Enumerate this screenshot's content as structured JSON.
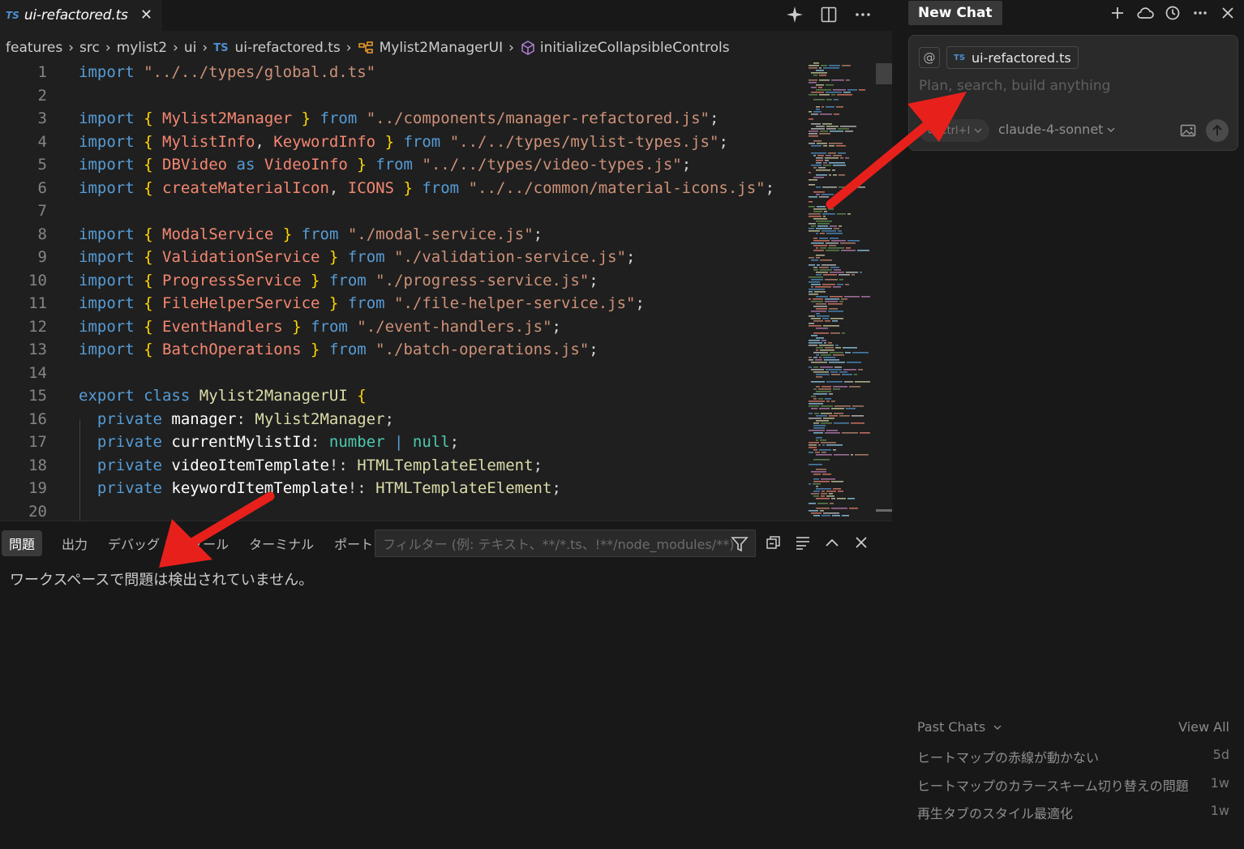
{
  "editor": {
    "tab": {
      "badge": "TS",
      "label": "ui-refactored.ts"
    },
    "tab_actions": [
      "sparkle-icon",
      "split-editor-icon",
      "more-icon"
    ],
    "breadcrumb": [
      {
        "label": "features"
      },
      {
        "label": "src"
      },
      {
        "label": "mylist2"
      },
      {
        "label": "ui"
      },
      {
        "label": "ui-refactored.ts",
        "badge": "TS"
      },
      {
        "label": "Mylist2ManagerUI",
        "icon": "class-icon"
      },
      {
        "label": "initializeCollapsibleControls",
        "icon": "method-cube-icon"
      }
    ],
    "code_lines": [
      {
        "n": "1",
        "tokens": [
          [
            "kw",
            "import"
          ],
          [
            "punc",
            " "
          ],
          [
            "str",
            "\"../../types/global.d.ts\""
          ]
        ]
      },
      {
        "n": "2",
        "tokens": []
      },
      {
        "n": "3",
        "tokens": [
          [
            "kw",
            "import"
          ],
          [
            "punc",
            " "
          ],
          [
            "br",
            "{"
          ],
          [
            "punc",
            " "
          ],
          [
            "ident",
            "Mylist2Manager"
          ],
          [
            "punc",
            " "
          ],
          [
            "br",
            "}"
          ],
          [
            "punc",
            " "
          ],
          [
            "kw",
            "from"
          ],
          [
            "punc",
            " "
          ],
          [
            "str",
            "\"../components/manager-refactored.js\""
          ],
          [
            "punc",
            ";"
          ]
        ]
      },
      {
        "n": "4",
        "tokens": [
          [
            "kw",
            "import"
          ],
          [
            "punc",
            " "
          ],
          [
            "br",
            "{"
          ],
          [
            "punc",
            " "
          ],
          [
            "ident",
            "MylistInfo"
          ],
          [
            "punc",
            ", "
          ],
          [
            "ident",
            "KeywordInfo"
          ],
          [
            "punc",
            " "
          ],
          [
            "br",
            "}"
          ],
          [
            "punc",
            " "
          ],
          [
            "kw",
            "from"
          ],
          [
            "punc",
            " "
          ],
          [
            "str",
            "\"../../types/mylist-types.js\""
          ],
          [
            "punc",
            ";"
          ]
        ]
      },
      {
        "n": "5",
        "tokens": [
          [
            "kw",
            "import"
          ],
          [
            "punc",
            " "
          ],
          [
            "br",
            "{"
          ],
          [
            "punc",
            " "
          ],
          [
            "ident",
            "DBVideo"
          ],
          [
            "punc",
            " "
          ],
          [
            "kw",
            "as"
          ],
          [
            "punc",
            " "
          ],
          [
            "ident",
            "VideoInfo"
          ],
          [
            "punc",
            " "
          ],
          [
            "br",
            "}"
          ],
          [
            "punc",
            " "
          ],
          [
            "kw",
            "from"
          ],
          [
            "punc",
            " "
          ],
          [
            "str",
            "\"../../types/video-types.js\""
          ],
          [
            "punc",
            ";"
          ]
        ]
      },
      {
        "n": "6",
        "tokens": [
          [
            "kw",
            "import"
          ],
          [
            "punc",
            " "
          ],
          [
            "br",
            "{"
          ],
          [
            "punc",
            " "
          ],
          [
            "ident",
            "createMaterialIcon"
          ],
          [
            "punc",
            ", "
          ],
          [
            "ident",
            "ICONS"
          ],
          [
            "punc",
            " "
          ],
          [
            "br",
            "}"
          ],
          [
            "punc",
            " "
          ],
          [
            "kw",
            "from"
          ],
          [
            "punc",
            " "
          ],
          [
            "str",
            "\"../../common/material-icons.js\""
          ],
          [
            "punc",
            ";"
          ]
        ]
      },
      {
        "n": "7",
        "tokens": []
      },
      {
        "n": "8",
        "tokens": [
          [
            "kw",
            "import"
          ],
          [
            "punc",
            " "
          ],
          [
            "br",
            "{"
          ],
          [
            "punc",
            " "
          ],
          [
            "ident",
            "ModalService"
          ],
          [
            "punc",
            " "
          ],
          [
            "br",
            "}"
          ],
          [
            "punc",
            " "
          ],
          [
            "kw",
            "from"
          ],
          [
            "punc",
            " "
          ],
          [
            "str",
            "\"./modal-service.js\""
          ],
          [
            "punc",
            ";"
          ]
        ]
      },
      {
        "n": "9",
        "tokens": [
          [
            "kw",
            "import"
          ],
          [
            "punc",
            " "
          ],
          [
            "br",
            "{"
          ],
          [
            "punc",
            " "
          ],
          [
            "ident",
            "ValidationService"
          ],
          [
            "punc",
            " "
          ],
          [
            "br",
            "}"
          ],
          [
            "punc",
            " "
          ],
          [
            "kw",
            "from"
          ],
          [
            "punc",
            " "
          ],
          [
            "str",
            "\"./validation-service.js\""
          ],
          [
            "punc",
            ";"
          ]
        ]
      },
      {
        "n": "10",
        "tokens": [
          [
            "kw",
            "import"
          ],
          [
            "punc",
            " "
          ],
          [
            "br",
            "{"
          ],
          [
            "punc",
            " "
          ],
          [
            "ident",
            "ProgressService"
          ],
          [
            "punc",
            " "
          ],
          [
            "br",
            "}"
          ],
          [
            "punc",
            " "
          ],
          [
            "kw",
            "from"
          ],
          [
            "punc",
            " "
          ],
          [
            "str",
            "\"./progress-service.js\""
          ],
          [
            "punc",
            ";"
          ]
        ]
      },
      {
        "n": "11",
        "tokens": [
          [
            "kw",
            "import"
          ],
          [
            "punc",
            " "
          ],
          [
            "br",
            "{"
          ],
          [
            "punc",
            " "
          ],
          [
            "ident",
            "FileHelperService"
          ],
          [
            "punc",
            " "
          ],
          [
            "br",
            "}"
          ],
          [
            "punc",
            " "
          ],
          [
            "kw",
            "from"
          ],
          [
            "punc",
            " "
          ],
          [
            "str",
            "\"./file-helper-service.js\""
          ],
          [
            "punc",
            ";"
          ]
        ]
      },
      {
        "n": "12",
        "tokens": [
          [
            "kw",
            "import"
          ],
          [
            "punc",
            " "
          ],
          [
            "br",
            "{"
          ],
          [
            "punc",
            " "
          ],
          [
            "ident",
            "EventHandlers"
          ],
          [
            "punc",
            " "
          ],
          [
            "br",
            "}"
          ],
          [
            "punc",
            " "
          ],
          [
            "kw",
            "from"
          ],
          [
            "punc",
            " "
          ],
          [
            "str",
            "\"./event-handlers.js\""
          ],
          [
            "punc",
            ";"
          ]
        ]
      },
      {
        "n": "13",
        "tokens": [
          [
            "kw",
            "import"
          ],
          [
            "punc",
            " "
          ],
          [
            "br",
            "{"
          ],
          [
            "punc",
            " "
          ],
          [
            "ident",
            "BatchOperations"
          ],
          [
            "punc",
            " "
          ],
          [
            "br",
            "}"
          ],
          [
            "punc",
            " "
          ],
          [
            "kw",
            "from"
          ],
          [
            "punc",
            " "
          ],
          [
            "str",
            "\"./batch-operations.js\""
          ],
          [
            "punc",
            ";"
          ]
        ]
      },
      {
        "n": "14",
        "tokens": []
      },
      {
        "n": "15",
        "tokens": [
          [
            "kw",
            "export"
          ],
          [
            "punc",
            " "
          ],
          [
            "kw",
            "class"
          ],
          [
            "punc",
            " "
          ],
          [
            "typ",
            "Mylist2ManagerUI"
          ],
          [
            "punc",
            " "
          ],
          [
            "br",
            "{"
          ]
        ]
      },
      {
        "n": "16",
        "tokens": [
          [
            "punc",
            "  "
          ],
          [
            "kw",
            "private"
          ],
          [
            "punc",
            " "
          ],
          [
            "prop",
            "manager"
          ],
          [
            "punc",
            ": "
          ],
          [
            "typ",
            "Mylist2Manager"
          ],
          [
            "punc",
            ";"
          ]
        ]
      },
      {
        "n": "17",
        "tokens": [
          [
            "punc",
            "  "
          ],
          [
            "kw",
            "private"
          ],
          [
            "punc",
            " "
          ],
          [
            "prop",
            "currentMylistId"
          ],
          [
            "punc",
            ": "
          ],
          [
            "cls",
            "number"
          ],
          [
            "punc",
            " "
          ],
          [
            "kw",
            "|"
          ],
          [
            "punc",
            " "
          ],
          [
            "cls",
            "null"
          ],
          [
            "punc",
            ";"
          ]
        ]
      },
      {
        "n": "18",
        "tokens": [
          [
            "punc",
            "  "
          ],
          [
            "kw",
            "private"
          ],
          [
            "punc",
            " "
          ],
          [
            "prop",
            "videoItemTemplate"
          ],
          [
            "punc",
            "!: "
          ],
          [
            "typ",
            "HTMLTemplateElement"
          ],
          [
            "punc",
            ";"
          ]
        ]
      },
      {
        "n": "19",
        "tokens": [
          [
            "punc",
            "  "
          ],
          [
            "kw",
            "private"
          ],
          [
            "punc",
            " "
          ],
          [
            "prop",
            "keywordItemTemplate"
          ],
          [
            "punc",
            "!: "
          ],
          [
            "typ",
            "HTMLTemplateElement"
          ],
          [
            "punc",
            ";"
          ]
        ]
      },
      {
        "n": "20",
        "tokens": []
      }
    ]
  },
  "panel": {
    "tabs": [
      "問題",
      "出力",
      "デバッグ コンソール",
      "ターミナル",
      "ポート"
    ],
    "active_tab": "問題",
    "filter_placeholder": "フィルター (例: テキスト、**/*.ts、!**/node_modules/**)",
    "message": "ワークスペースで問題は検出されていません。"
  },
  "chat": {
    "tab_label": "New Chat",
    "header_actions": [
      "plus-icon",
      "cloud-icon",
      "history-icon",
      "more-icon",
      "close-icon"
    ],
    "composer": {
      "at_symbol": "@",
      "context_badge": "TS",
      "context_file": "ui-refactored.ts",
      "placeholder": "Plan, search, build anything",
      "mode_symbol": "∞",
      "mode_shortcut": "Ctrl+I",
      "model": "claude-4-sonnet"
    },
    "past_chats": {
      "title": "Past Chats",
      "view_all": "View All",
      "items": [
        {
          "title": "ヒートマップの赤線が動かない",
          "age": "5d"
        },
        {
          "title": "ヒートマップのカラースキーム切り替えの問題",
          "age": "1w"
        },
        {
          "title": "再生タブのスタイル最適化",
          "age": "1w"
        }
      ]
    }
  },
  "colors": {
    "keyword": "#569cd6",
    "string": "#ce9178",
    "identifier": "#f48771",
    "bracket": "#ffd700",
    "type": "#dcdcaa",
    "annotation_arrow": "#e8201c"
  }
}
